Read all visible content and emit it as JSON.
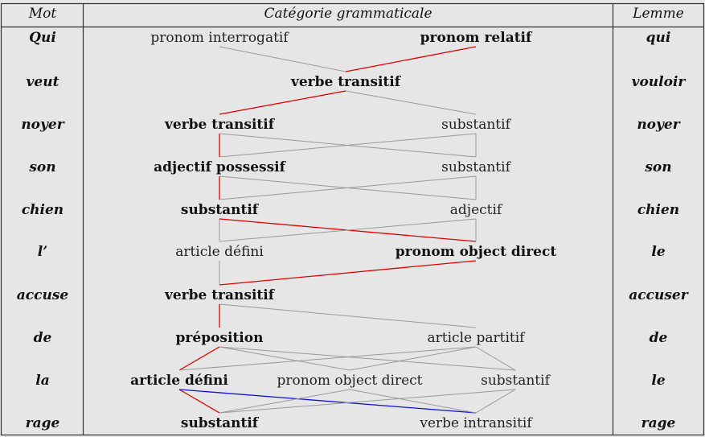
{
  "headers": {
    "word": "Mot",
    "category": "Catégorie grammaticale",
    "lemma": "Lemme"
  },
  "rows": [
    {
      "word": "Qui",
      "lemma": "qui"
    },
    {
      "word": "veut",
      "lemma": "vouloir"
    },
    {
      "word": "noyer",
      "lemma": "noyer"
    },
    {
      "word": "son",
      "lemma": "son"
    },
    {
      "word": "chien",
      "lemma": "chien"
    },
    {
      "word": "l’",
      "lemma": "le"
    },
    {
      "word": "accuse",
      "lemma": "accuser"
    },
    {
      "word": "de",
      "lemma": "de"
    },
    {
      "word": "la",
      "lemma": "le"
    },
    {
      "word": "rage",
      "lemma": "rage"
    }
  ],
  "categories": [
    {
      "id": "q1",
      "row": 0,
      "label": "pronom interrogatif",
      "bold": false
    },
    {
      "id": "q2",
      "row": 0,
      "label": "pronom relatif",
      "bold": true
    },
    {
      "id": "v1",
      "row": 1,
      "label": "verbe transitif",
      "bold": true
    },
    {
      "id": "n1",
      "row": 2,
      "label": "verbe transitif",
      "bold": true
    },
    {
      "id": "n2",
      "row": 2,
      "label": "substantif",
      "bold": false
    },
    {
      "id": "s1",
      "row": 3,
      "label": "adjectif possessif",
      "bold": true
    },
    {
      "id": "s2",
      "row": 3,
      "label": "substantif",
      "bold": false
    },
    {
      "id": "c1",
      "row": 4,
      "label": "substantif",
      "bold": true
    },
    {
      "id": "c2",
      "row": 4,
      "label": "adjectif",
      "bold": false
    },
    {
      "id": "l1",
      "row": 5,
      "label": "article défini",
      "bold": false
    },
    {
      "id": "l2",
      "row": 5,
      "label": "pronom object direct",
      "bold": true
    },
    {
      "id": "a1",
      "row": 6,
      "label": "verbe transitif",
      "bold": true
    },
    {
      "id": "d1",
      "row": 7,
      "label": "préposition",
      "bold": true
    },
    {
      "id": "d2",
      "row": 7,
      "label": "article partitif",
      "bold": false
    },
    {
      "id": "la1",
      "row": 8,
      "label": "article défini",
      "bold": true
    },
    {
      "id": "la2",
      "row": 8,
      "label": "pronom object direct",
      "bold": false
    },
    {
      "id": "la3",
      "row": 8,
      "label": "substantif",
      "bold": false
    },
    {
      "id": "r1",
      "row": 9,
      "label": "substantif",
      "bold": true
    },
    {
      "id": "r2",
      "row": 9,
      "label": "verbe intransitif",
      "bold": false
    }
  ],
  "edges": [
    {
      "from": "q1",
      "to": "v1",
      "kind": "gray"
    },
    {
      "from": "q2",
      "to": "v1",
      "kind": "red"
    },
    {
      "from": "v1",
      "to": "n1",
      "kind": "red"
    },
    {
      "from": "v1",
      "to": "n2",
      "kind": "gray"
    },
    {
      "from": "n1",
      "to": "s1",
      "kind": "red"
    },
    {
      "from": "n1",
      "to": "s2",
      "kind": "gray"
    },
    {
      "from": "n2",
      "to": "s1",
      "kind": "gray"
    },
    {
      "from": "n2",
      "to": "s2",
      "kind": "gray"
    },
    {
      "from": "s1",
      "to": "c1",
      "kind": "red"
    },
    {
      "from": "s1",
      "to": "c2",
      "kind": "gray"
    },
    {
      "from": "s2",
      "to": "c1",
      "kind": "gray"
    },
    {
      "from": "s2",
      "to": "c2",
      "kind": "gray"
    },
    {
      "from": "c1",
      "to": "l1",
      "kind": "gray"
    },
    {
      "from": "c1",
      "to": "l2",
      "kind": "red"
    },
    {
      "from": "c2",
      "to": "l1",
      "kind": "gray"
    },
    {
      "from": "c2",
      "to": "l2",
      "kind": "gray"
    },
    {
      "from": "l1",
      "to": "a1",
      "kind": "gray"
    },
    {
      "from": "l2",
      "to": "a1",
      "kind": "red"
    },
    {
      "from": "a1",
      "to": "d1",
      "kind": "red"
    },
    {
      "from": "a1",
      "to": "d2",
      "kind": "gray"
    },
    {
      "from": "d1",
      "to": "la1",
      "kind": "red"
    },
    {
      "from": "d1",
      "to": "la2",
      "kind": "gray"
    },
    {
      "from": "d1",
      "to": "la3",
      "kind": "gray"
    },
    {
      "from": "d2",
      "to": "la1",
      "kind": "gray"
    },
    {
      "from": "d2",
      "to": "la2",
      "kind": "gray"
    },
    {
      "from": "d2",
      "to": "la3",
      "kind": "gray"
    },
    {
      "from": "la1",
      "to": "r1",
      "kind": "red"
    },
    {
      "from": "la1",
      "to": "r2",
      "kind": "blue"
    },
    {
      "from": "la2",
      "to": "r1",
      "kind": "gray"
    },
    {
      "from": "la2",
      "to": "r2",
      "kind": "gray"
    },
    {
      "from": "la3",
      "to": "r1",
      "kind": "gray"
    },
    {
      "from": "la3",
      "to": "r2",
      "kind": "gray"
    }
  ],
  "colors": {
    "gray": "#999999",
    "red": "#e00000",
    "blue": "#1010e0",
    "border": "#333333",
    "background": "#e6e6e6"
  }
}
